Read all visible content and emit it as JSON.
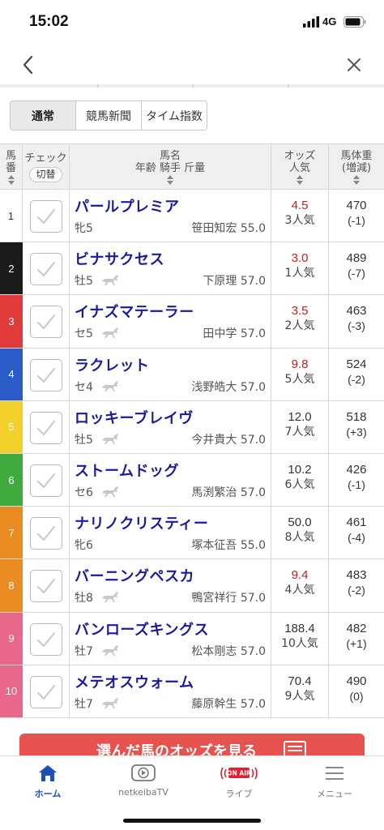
{
  "status_bar": {
    "time": "15:02",
    "network": "4G"
  },
  "tabs": [
    {
      "label": "通常",
      "active": true
    },
    {
      "label": "競馬新聞",
      "active": false
    },
    {
      "label": "タイム指数",
      "active": false
    }
  ],
  "table_header": {
    "num": [
      "馬",
      "番"
    ],
    "check": "チェック",
    "check_toggle": "切替",
    "name_top": "馬名",
    "name_bottom": "年齢 騎手 斤量",
    "odds_top": "オッズ",
    "odds_bottom": "人気",
    "weight_top": "馬体重",
    "weight_bottom": "(増減)"
  },
  "horses": [
    {
      "num": "1",
      "frame_color": "#ffffff",
      "num_color": "#333333",
      "name": "パールプレミア",
      "sex_age": "牝5",
      "jockey_weight": "笹田知宏 55.0",
      "odds": "4.5",
      "odds_fav": true,
      "popularity": "3人気",
      "body_weight": "470",
      "weight_diff": "(-1)",
      "show_horse_icon": false
    },
    {
      "num": "2",
      "frame_color": "#1a1a1a",
      "num_color": "#ffffff",
      "name": "ビナサクセス",
      "sex_age": "牡5",
      "jockey_weight": "下原理 57.0",
      "odds": "3.0",
      "odds_fav": true,
      "popularity": "1人気",
      "body_weight": "489",
      "weight_diff": "(-7)",
      "show_horse_icon": true
    },
    {
      "num": "3",
      "frame_color": "#e03a3a",
      "num_color": "#ffffff",
      "name": "イナズマテーラー",
      "sex_age": "セ5",
      "jockey_weight": "田中学 57.0",
      "odds": "3.5",
      "odds_fav": true,
      "popularity": "2人気",
      "body_weight": "463",
      "weight_diff": "(-3)",
      "show_horse_icon": true
    },
    {
      "num": "4",
      "frame_color": "#2a5bc8",
      "num_color": "#ffffff",
      "name": "ラクレット",
      "sex_age": "セ4",
      "jockey_weight": "浅野皓大 57.0",
      "odds": "9.8",
      "odds_fav": true,
      "popularity": "5人気",
      "body_weight": "524",
      "weight_diff": "(-2)",
      "show_horse_icon": true
    },
    {
      "num": "5",
      "frame_color": "#f2d12a",
      "num_color": "#ffffff",
      "name": "ロッキーブレイヴ",
      "sex_age": "牡5",
      "jockey_weight": "今井貴大 57.0",
      "odds": "12.0",
      "odds_fav": false,
      "popularity": "7人気",
      "body_weight": "518",
      "weight_diff": "(+3)",
      "show_horse_icon": true
    },
    {
      "num": "6",
      "frame_color": "#3fab3f",
      "num_color": "#ffffff",
      "name": "ストームドッグ",
      "sex_age": "セ6",
      "jockey_weight": "馬渕繁治 57.0",
      "odds": "10.2",
      "odds_fav": false,
      "popularity": "6人気",
      "body_weight": "426",
      "weight_diff": "(-1)",
      "show_horse_icon": true
    },
    {
      "num": "7",
      "frame_color": "#ea8c22",
      "num_color": "#ffffff",
      "name": "ナリノクリスティー",
      "sex_age": "牝6",
      "jockey_weight": "塚本征吾 55.0",
      "odds": "50.0",
      "odds_fav": false,
      "popularity": "8人気",
      "body_weight": "461",
      "weight_diff": "(-4)",
      "show_horse_icon": false
    },
    {
      "num": "8",
      "frame_color": "#ea8c22",
      "num_color": "#ffffff",
      "name": "バーニングペスカ",
      "sex_age": "牡8",
      "jockey_weight": "鴨宮祥行 57.0",
      "odds": "9.4",
      "odds_fav": true,
      "popularity": "4人気",
      "body_weight": "483",
      "weight_diff": "(-2)",
      "show_horse_icon": true
    },
    {
      "num": "9",
      "frame_color": "#e8678a",
      "num_color": "#ffffff",
      "name": "バンローズキングス",
      "sex_age": "牡7",
      "jockey_weight": "松本剛志 57.0",
      "odds": "188.4",
      "odds_fav": false,
      "popularity": "10人気",
      "body_weight": "482",
      "weight_diff": "(+1)",
      "show_horse_icon": true
    },
    {
      "num": "10",
      "frame_color": "#e8678a",
      "num_color": "#ffffff",
      "name": "メテオスウォーム",
      "sex_age": "牡7",
      "jockey_weight": "藤原幹生 57.0",
      "odds": "70.4",
      "odds_fav": false,
      "popularity": "9人気",
      "body_weight": "490",
      "weight_diff": "(0)",
      "show_horse_icon": true
    }
  ],
  "cta": {
    "label": "選んだ馬のオッズを見る"
  },
  "tab_bar": [
    {
      "label": "ホーム",
      "icon": "home-icon",
      "active": true
    },
    {
      "label": "netkeibaTV",
      "icon": "tv-play-icon",
      "active": false
    },
    {
      "label": "ライブ",
      "icon": "on-air-icon",
      "badge": "ON AIR",
      "active": false
    },
    {
      "label": "メニュー",
      "icon": "menu-icon",
      "active": false
    }
  ],
  "colors": {
    "accent_blue": "#1e4fb4",
    "horse_name": "#1a1a9e",
    "odds_fav": "#c81e1e",
    "cta": "#e8524e"
  }
}
